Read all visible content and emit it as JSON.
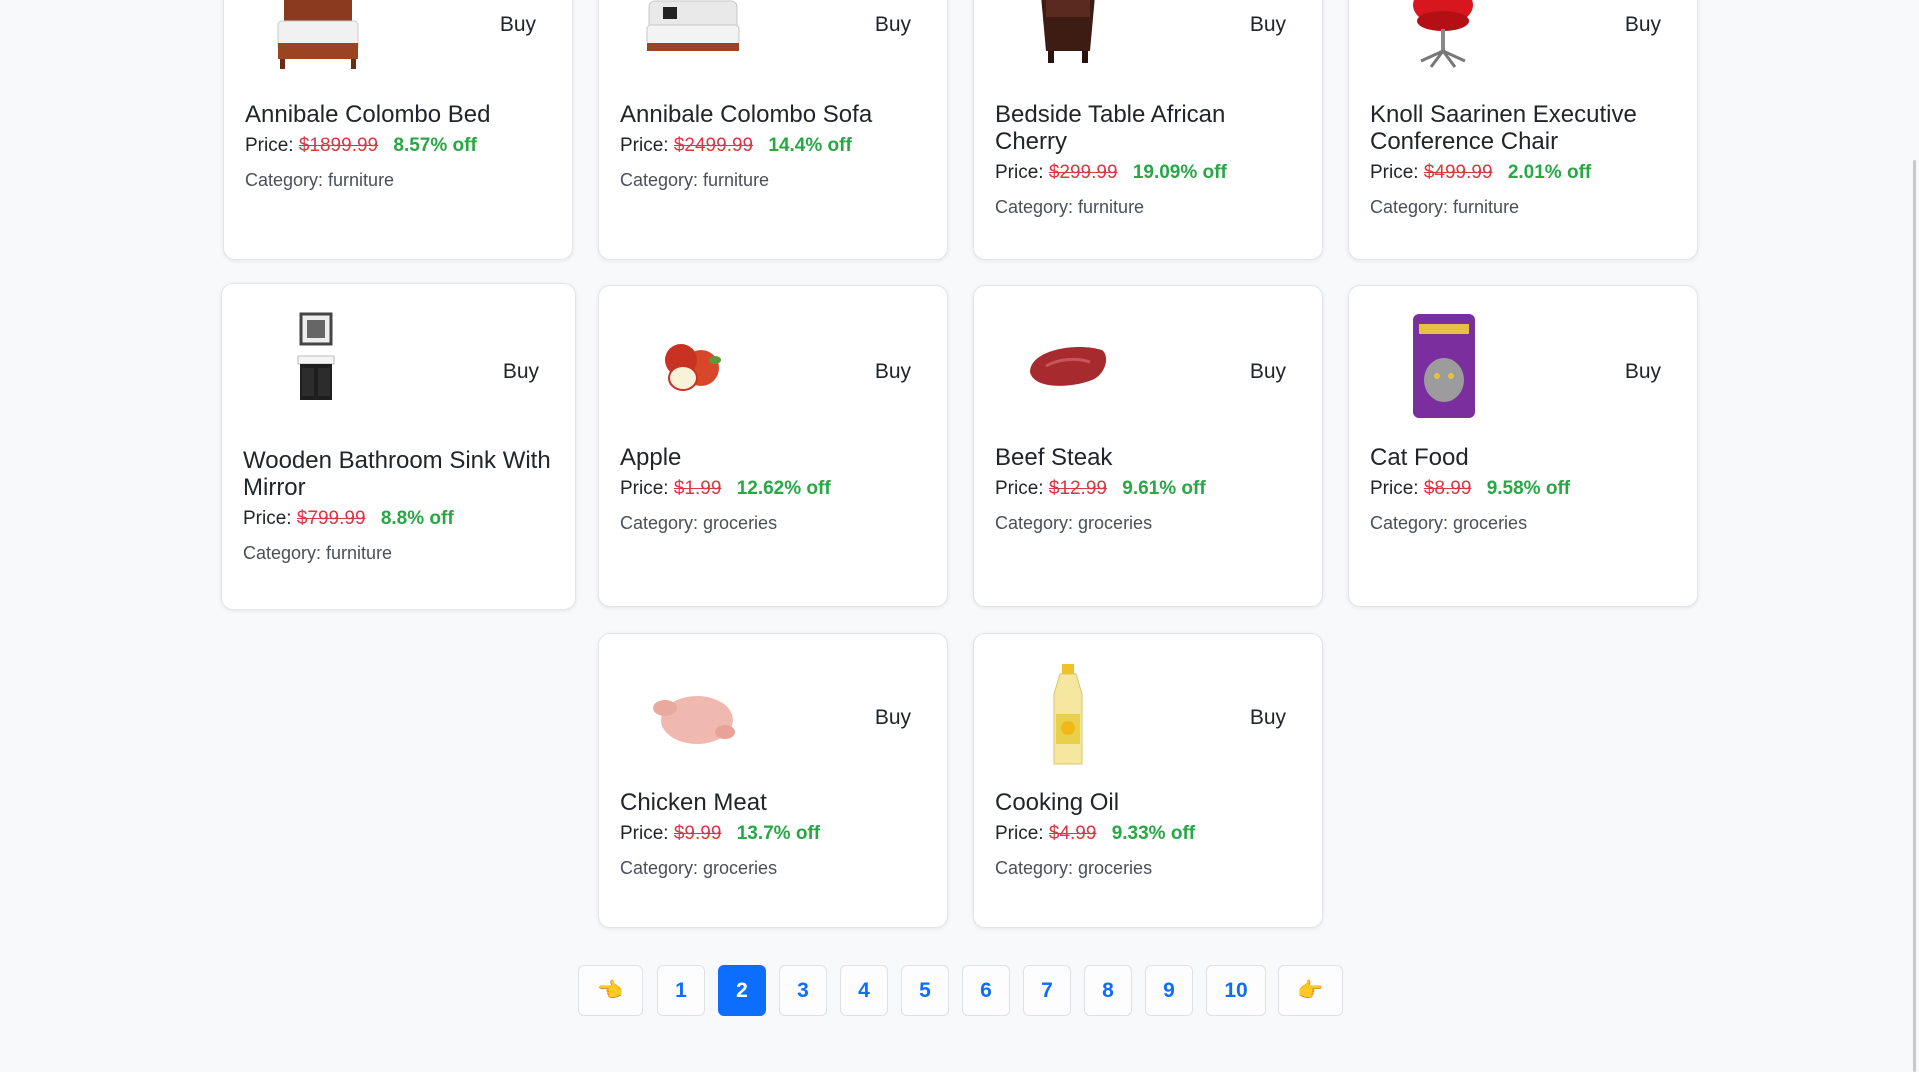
{
  "products": [
    {
      "title": "Annibale Colombo Bed",
      "price_label": "Price:",
      "price": "$1899.99",
      "discount": "8.57% off",
      "category": "Category: furniture",
      "buy": "Buy",
      "image": "bed-image"
    },
    {
      "title": "Annibale Colombo Sofa",
      "price_label": "Price:",
      "price": "$2499.99",
      "discount": "14.4% off",
      "category": "Category: furniture",
      "buy": "Buy",
      "image": "sofa-image"
    },
    {
      "title": "Bedside Table African Cherry",
      "price_label": "Price:",
      "price": "$299.99",
      "discount": "19.09% off",
      "category": "Category: furniture",
      "buy": "Buy",
      "image": "bedside-table-image"
    },
    {
      "title": "Knoll Saarinen Executive Conference Chair",
      "price_label": "Price:",
      "price": "$499.99",
      "discount": "2.01% off",
      "category": "Category: furniture",
      "buy": "Buy",
      "image": "chair-image"
    },
    {
      "title": "Wooden Bathroom Sink With Mirror",
      "price_label": "Price:",
      "price": "$799.99",
      "discount": "8.8% off",
      "category": "Category: furniture",
      "buy": "Buy",
      "image": "bathroom-sink-image"
    },
    {
      "title": "Apple",
      "price_label": "Price:",
      "price": "$1.99",
      "discount": "12.62% off",
      "category": "Category: groceries",
      "buy": "Buy",
      "image": "apple-image"
    },
    {
      "title": "Beef Steak",
      "price_label": "Price:",
      "price": "$12.99",
      "discount": "9.61% off",
      "category": "Category: groceries",
      "buy": "Buy",
      "image": "beef-steak-image"
    },
    {
      "title": "Cat Food",
      "price_label": "Price:",
      "price": "$8.99",
      "discount": "9.58% off",
      "category": "Category: groceries",
      "buy": "Buy",
      "image": "cat-food-image"
    },
    {
      "title": "Chicken Meat",
      "price_label": "Price:",
      "price": "$9.99",
      "discount": "13.7% off",
      "category": "Category: groceries",
      "buy": "Buy",
      "image": "chicken-image"
    },
    {
      "title": "Cooking Oil",
      "price_label": "Price:",
      "price": "$4.99",
      "discount": "9.33% off",
      "category": "Category: groceries",
      "buy": "Buy",
      "image": "cooking-oil-image"
    }
  ],
  "pagination": {
    "prev_icon": "👈",
    "next_icon": "👉",
    "pages": [
      "1",
      "2",
      "3",
      "4",
      "5",
      "6",
      "7",
      "8",
      "9",
      "10"
    ],
    "current": "2"
  },
  "colors": {
    "accent": "#0d6efd",
    "old_price": "#dc3545",
    "discount": "#28a745"
  }
}
